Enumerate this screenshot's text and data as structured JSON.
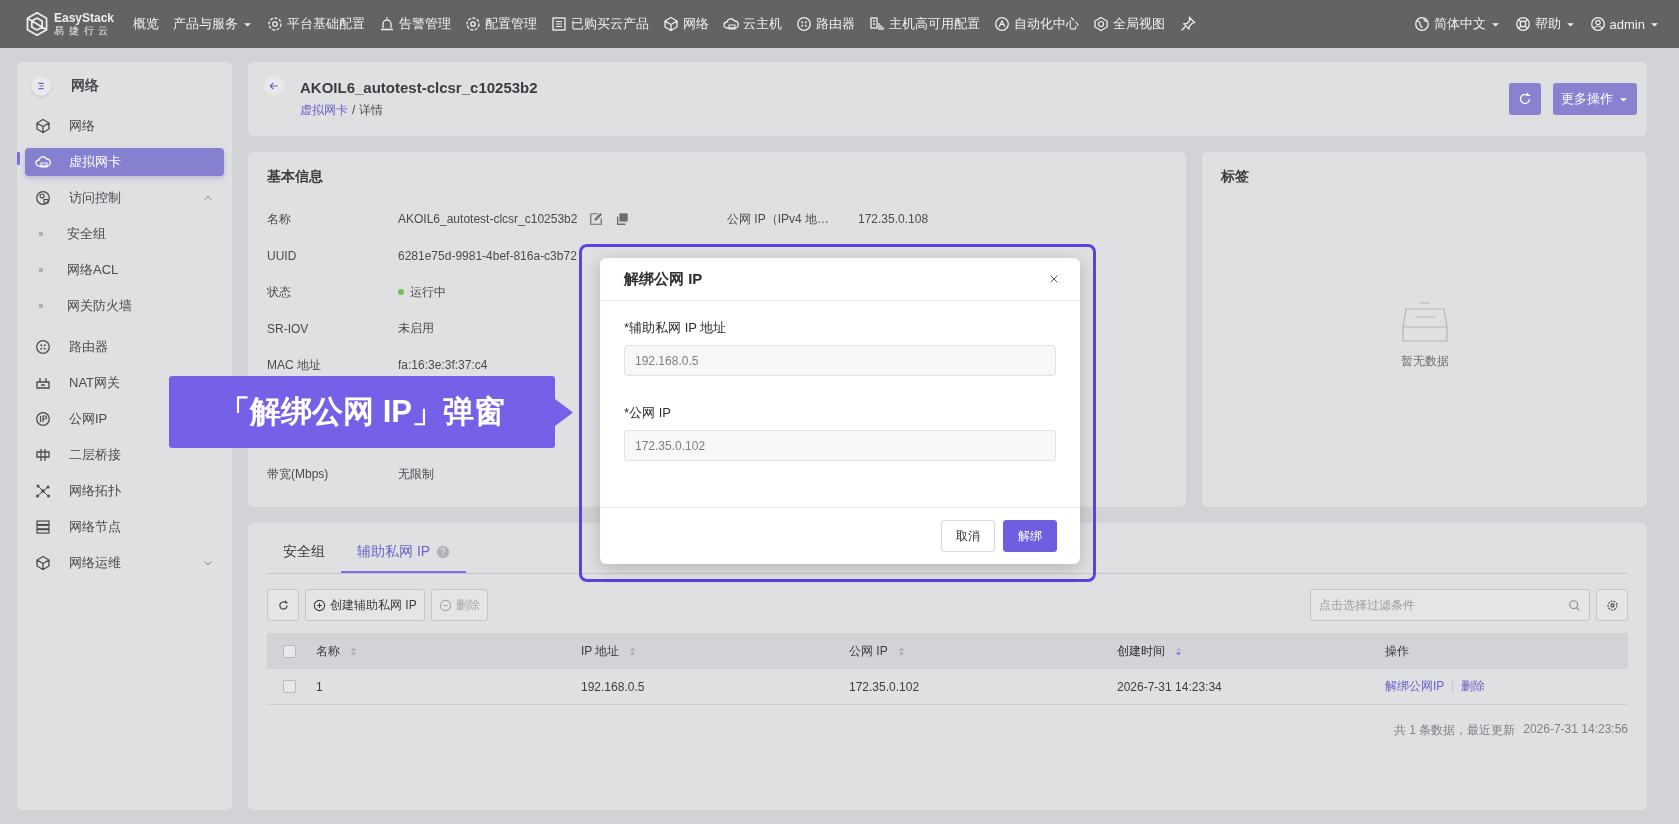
{
  "topbar": {
    "logo": {
      "name": "EasyStack",
      "subtitle": "易 捷 行 云"
    },
    "nav": [
      {
        "label": "概览",
        "kind": "plain"
      },
      {
        "label": "产品与服务",
        "kind": "menu"
      },
      {
        "label": "平台基础配置",
        "kind": "icon"
      },
      {
        "label": "告警管理",
        "kind": "icon"
      },
      {
        "label": "配置管理",
        "kind": "icon"
      },
      {
        "label": "已购买云产品",
        "kind": "icon"
      },
      {
        "label": "网络",
        "kind": "icon"
      },
      {
        "label": "云主机",
        "kind": "icon"
      },
      {
        "label": "路由器",
        "kind": "icon"
      },
      {
        "label": "主机高可用配置",
        "kind": "icon"
      },
      {
        "label": "自动化中心",
        "kind": "icon"
      },
      {
        "label": "全局视图",
        "kind": "icon"
      },
      {
        "kind": "pin"
      }
    ],
    "right": [
      {
        "label": "简体中文"
      },
      {
        "label": "帮助"
      },
      {
        "label": "admin"
      }
    ]
  },
  "sidebar": {
    "title": "网络",
    "items": [
      {
        "label": "网络",
        "selected": false
      },
      {
        "label": "虚拟网卡",
        "selected": true
      },
      {
        "label": "访问控制",
        "selected": false,
        "expanded": true,
        "children": [
          {
            "label": "安全组",
            "selected": false
          },
          {
            "label": "网络ACL",
            "selected": false
          },
          {
            "label": "网关防火墙",
            "selected": false
          }
        ]
      },
      {
        "label": "路由器",
        "selected": false
      },
      {
        "label": "NAT网关",
        "selected": false
      },
      {
        "label": "公网IP",
        "selected": false
      },
      {
        "label": "二层桥接",
        "selected": false
      },
      {
        "label": "网络拓扑",
        "selected": false
      },
      {
        "label": "网络节点",
        "selected": false
      },
      {
        "label": "网络运维",
        "selected": false,
        "expanded": false
      }
    ]
  },
  "header": {
    "title": "AKOIL6_autotest-clcsr_c10253b2",
    "breadcrumb": [
      {
        "label": "虚拟网卡",
        "link": true
      },
      {
        "label": "/ 详情",
        "link": false
      }
    ],
    "more_button": "更多操作"
  },
  "basic_info": {
    "title": "基本信息",
    "left": [
      {
        "label": "名称",
        "value": "AKOIL6_autotest-clcsr_c10253b2",
        "kind": "editable"
      },
      {
        "label": "UUID",
        "value": "6281e75d-9981-4bef-816a-c3b72",
        "kind": "plain"
      },
      {
        "label": "状态",
        "value": "运行中",
        "kind": "status",
        "color": "#6fbf5a"
      },
      {
        "label": "SR-IOV",
        "value": "未启用",
        "kind": "plain"
      },
      {
        "label": "MAC 地址",
        "value": "fa:16:3e:3f:37:c4",
        "kind": "plain"
      },
      {
        "kind": "gap"
      },
      {
        "kind": "gap"
      },
      {
        "label": "带宽(Mbps)",
        "value": "无限制",
        "kind": "plain"
      }
    ],
    "right": [
      {
        "label": "公网 IP（IPv4 地…",
        "value": "172.35.0.108"
      }
    ]
  },
  "tags": {
    "title": "标签",
    "empty_text": "暂无数据"
  },
  "detail_tabs": {
    "tabs": [
      {
        "label": "安全组",
        "selected": false
      },
      {
        "label": "辅助私网 IP",
        "selected": true
      }
    ],
    "toolbar": {
      "create_button": "创建辅助私网 IP",
      "delete_button": {
        "label": "删除",
        "disabled": true
      },
      "filter": {
        "placeholder": "点击选择过滤条件"
      }
    },
    "table": {
      "all_checked": false,
      "columns": [
        {
          "label": "名称",
          "sortable": true,
          "sorted": false
        },
        {
          "label": "IP 地址",
          "sortable": true,
          "sorted": false
        },
        {
          "label": "公网 IP",
          "sortable": true,
          "sorted": false
        },
        {
          "label": "创建时间",
          "sortable": true,
          "sorted": true
        },
        {
          "label": "操作",
          "sortable": false,
          "sorted": false
        }
      ],
      "rows": [
        {
          "checked": false,
          "cells": [
            "1",
            "192.168.0.5",
            "172.35.0.102",
            "2026-7-31 14:23:34"
          ],
          "actions": [
            "解绑公网IP",
            "删除"
          ]
        }
      ]
    },
    "footer": {
      "summary": "共 1 条数据，最近更新",
      "updated": "2026-7-31 14:23:56"
    }
  },
  "modal": {
    "title": "解绑公网 IP",
    "fields": [
      {
        "label": "*辅助私网 IP 地址",
        "value": "192.168.0.5",
        "disabled": true
      },
      {
        "label": "*公网 IP",
        "value": "172.35.0.102",
        "disabled": true
      }
    ],
    "buttons": [
      {
        "label": "取消",
        "primary": false
      },
      {
        "label": "解绑",
        "primary": true
      }
    ]
  },
  "callout": {
    "text": "「解绑公网 IP」弹窗"
  }
}
